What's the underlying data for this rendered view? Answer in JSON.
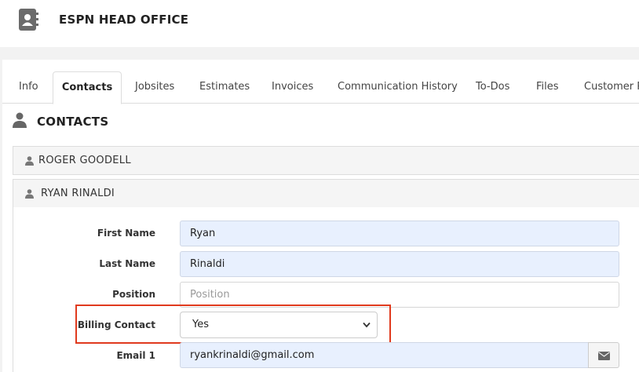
{
  "header": {
    "company_name": "ESPN HEAD OFFICE"
  },
  "tabs": [
    {
      "label": "Info"
    },
    {
      "label": "Contacts",
      "active": true
    },
    {
      "label": "Jobsites"
    },
    {
      "label": "Estimates"
    },
    {
      "label": "Invoices"
    },
    {
      "label": "Communication History"
    },
    {
      "label": "To-Dos"
    },
    {
      "label": "Files"
    },
    {
      "label": "Customer P"
    }
  ],
  "section": {
    "title": "CONTACTS"
  },
  "contacts": [
    {
      "name": "ROGER GOODELL"
    },
    {
      "name": "RYAN  RINALDI"
    }
  ],
  "form": {
    "first_name_label": "First Name",
    "first_name_value": "Ryan",
    "last_name_label": "Last Name",
    "last_name_value": "Rinaldi",
    "position_label": "Position",
    "position_placeholder": "Position",
    "billing_label": "Billing Contact",
    "billing_value": "Yes",
    "email1_label": "Email 1",
    "email1_value": "ryankrinaldi@gmail.com"
  },
  "colors": {
    "highlight": "#e03a1e",
    "autofill_bg": "#e8f0fe"
  },
  "icons": {
    "company": "address-book-icon",
    "person": "user-icon",
    "email": "envelope-icon",
    "select": "chevron-down-icon"
  }
}
